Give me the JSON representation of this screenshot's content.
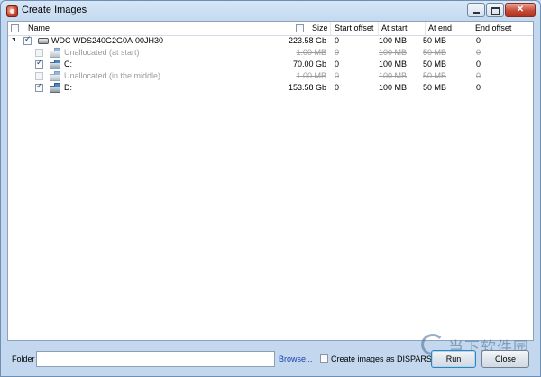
{
  "window": {
    "title": "Create Images"
  },
  "columns": {
    "name": "Name",
    "size": "Size",
    "start_offset": "Start offset",
    "at_start": "At start",
    "at_end": "At end",
    "end_offset": "End offset"
  },
  "rows": [
    {
      "name": "WDC WDS240G2G0A-00JH30",
      "size": "223.58 Gb",
      "start_offset": "0",
      "at_start": "100 MB",
      "at_end": "50 MB",
      "end_offset": "0",
      "checked": true,
      "icon": "hard-drive-icon",
      "dimmed": false
    },
    {
      "name": "Unallocated (at start)",
      "size": "1.00 MB",
      "start_offset": "0",
      "at_start": "100 MB",
      "at_end": "50 MB",
      "end_offset": "0",
      "checked": false,
      "icon": "volume-icon",
      "dimmed": true
    },
    {
      "name": "C:",
      "size": "70.00 Gb",
      "start_offset": "0",
      "at_start": "100 MB",
      "at_end": "50 MB",
      "end_offset": "0",
      "checked": true,
      "icon": "volume-icon",
      "dimmed": false
    },
    {
      "name": "Unallocated (in the middle)",
      "size": "1.00 MB",
      "start_offset": "0",
      "at_start": "100 MB",
      "at_end": "50 MB",
      "end_offset": "0",
      "checked": false,
      "icon": "volume-icon",
      "dimmed": true
    },
    {
      "name": "D:",
      "size": "153.58 Gb",
      "start_offset": "0",
      "at_start": "100 MB",
      "at_end": "50 MB",
      "end_offset": "0",
      "checked": true,
      "icon": "volume-icon",
      "dimmed": false
    }
  ],
  "bottom": {
    "folder_label": "Folder",
    "folder_value": "",
    "browse": "Browse...",
    "disperse_label": "Create images as DISPARSE",
    "disperse_checked": false,
    "run": "Run",
    "close": "Close"
  },
  "watermark": {
    "text": "当下软件园"
  },
  "colors": {
    "title_bar": "#c3d8ee",
    "link": "#1b3fb4",
    "dim_text": "#9a9a9a"
  }
}
